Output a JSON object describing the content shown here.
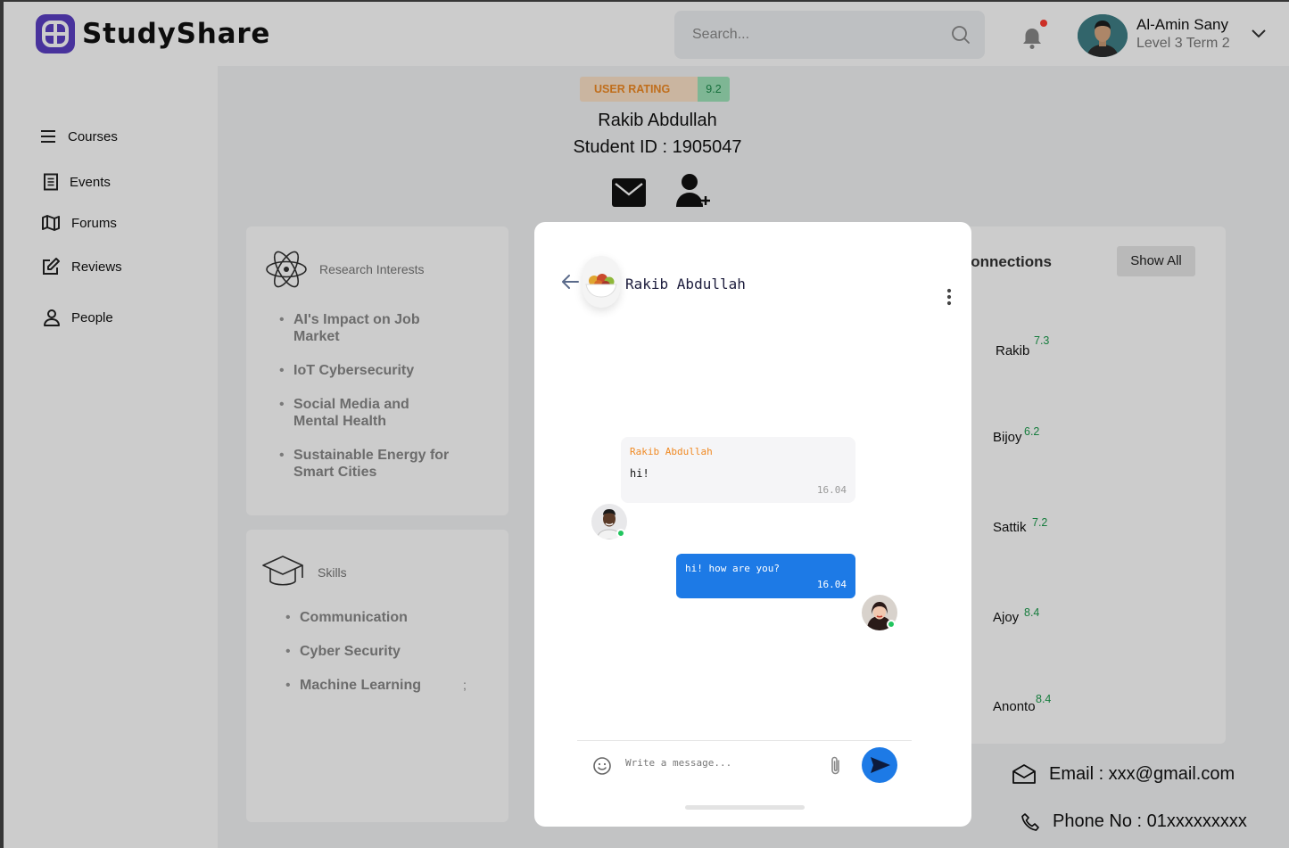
{
  "app": {
    "brand": "StudyShare"
  },
  "header": {
    "search_placeholder": "Search...",
    "user": {
      "name": "Al-Amin Sany",
      "level": "Level 3 Term 2"
    }
  },
  "sidebar": {
    "items": [
      {
        "label": "Courses",
        "icon": "menu-icon"
      },
      {
        "label": "Events",
        "icon": "document-icon"
      },
      {
        "label": "Forums",
        "icon": "map-icon"
      },
      {
        "label": "Reviews",
        "icon": "edit-icon"
      },
      {
        "label": "People",
        "icon": "person-icon"
      }
    ]
  },
  "profile": {
    "rating_label": "USER RATING",
    "rating_value": "9.2",
    "name": "Rakib Abdullah",
    "student_id": "Student ID : 1905047",
    "research": {
      "title": "Research Interests",
      "items": [
        "AI's Impact on Job Market",
        "IoT Cybersecurity",
        "Social Media and Mental Health",
        "Sustainable Energy for Smart Cities"
      ]
    },
    "skills": {
      "title": "Skills",
      "items": [
        "Communication",
        "Cyber Security",
        "Machine Learning"
      ],
      "stray_mark": ";"
    },
    "connections": {
      "title": "Connections",
      "show_all": "Show All",
      "items": [
        {
          "name": "Rakib",
          "score": "7.3"
        },
        {
          "name": "Bijoy",
          "score": "6.2"
        },
        {
          "name": "Sattik",
          "score": "7.2"
        },
        {
          "name": "Ajoy",
          "score": "8.4"
        },
        {
          "name": "Anonto",
          "score": "8.4"
        }
      ]
    },
    "email": "Email : xxx@gmail.com",
    "phone": "Phone No : 01xxxxxxxxx"
  },
  "chat": {
    "contact_name": "Rakib Abdullah",
    "messages": [
      {
        "direction": "incoming",
        "sender": "Rakib Abdullah",
        "text": "hi!",
        "time": "16.04"
      },
      {
        "direction": "outgoing",
        "text": "hi! how are you?",
        "time": "16.04"
      }
    ],
    "input_placeholder": "Write a message..."
  },
  "colors": {
    "brand": "#5b3fc4",
    "primary_blue": "#1d7ae6",
    "rating_orange": "#f08a24",
    "score_green": "#1c9c4d",
    "online_green": "#22c55e"
  }
}
